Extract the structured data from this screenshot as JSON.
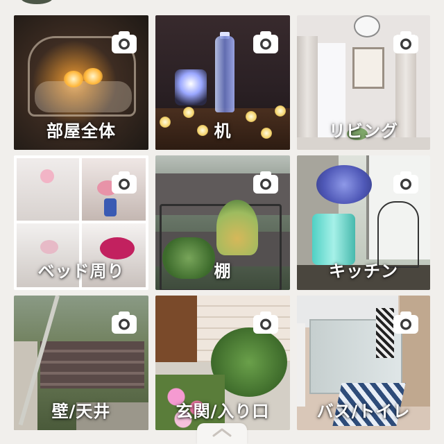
{
  "categories": [
    {
      "label": "部屋全体",
      "icon": "camera-icon"
    },
    {
      "label": "机",
      "icon": "camera-icon"
    },
    {
      "label": "リビング",
      "icon": "camera-icon"
    },
    {
      "label": "ベッド周り",
      "icon": "camera-icon"
    },
    {
      "label": "棚",
      "icon": "camera-icon"
    },
    {
      "label": "キッチン",
      "icon": "camera-icon"
    },
    {
      "label": "壁/天井",
      "icon": "camera-icon"
    },
    {
      "label": "玄関/入り口",
      "icon": "camera-icon"
    },
    {
      "label": "バス/トイレ",
      "icon": "camera-icon"
    }
  ],
  "bottom_handle": {
    "icon": "chevron-up-icon"
  },
  "colors": {
    "background": "#f1efec",
    "label_text": "#ffffff",
    "camera_badge": "#ffffff"
  }
}
